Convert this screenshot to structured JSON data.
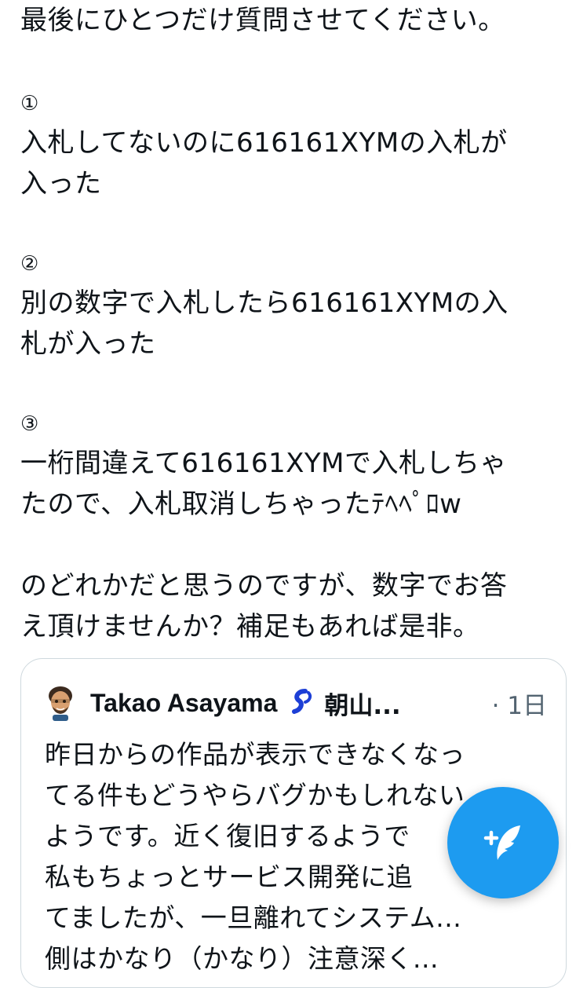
{
  "tweet": {
    "lines": [
      "最後にひとつだけ質問させてください。",
      "",
      "①",
      "入札してないのに616161XYMの入札が",
      "入った",
      "",
      "②",
      "別の数字で入札したら616161XYMの入",
      "札が入った",
      "",
      "③",
      "一桁間違えて616161XYMで入札しちゃ",
      "たので、入札取消しちゃったﾃﾍﾍﾟﾛw",
      "",
      "のどれかだと思うのですが、数字でお答",
      "え頂けませんか？補足もあれば是非。"
    ]
  },
  "quoted_tweet": {
    "author_name": "Takao Asayama",
    "author_handle": "朝山...",
    "time": "· 1日",
    "lines": [
      "昨日からの作品が表示できなくなっ",
      "てる件もどうやらバグかもしれない",
      "ようです。近く復旧するようで",
      "私もちょっとサービス開発に追",
      "てましたが、一旦離れてシステム...",
      "側はかなり（かなり）注意深く..."
    ]
  },
  "compose_button": {
    "icon": "compose-feather-icon",
    "color": "#1d9bf0"
  }
}
